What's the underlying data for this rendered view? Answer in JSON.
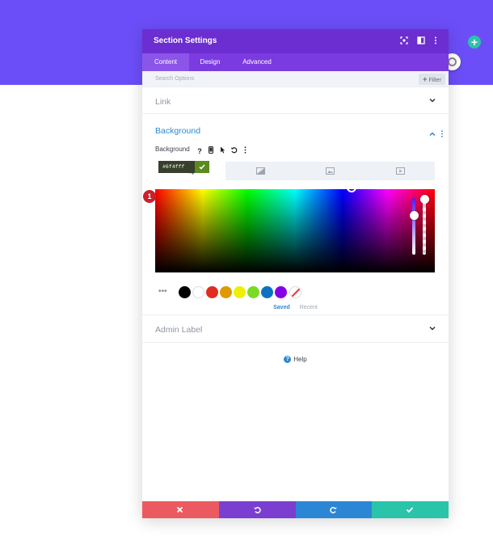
{
  "colors": {
    "top_band": "#6c4ef8",
    "header": "#6c2ed0",
    "tabs": "#7b3be0",
    "accent_blue": "#2e88cf",
    "footer_cancel": "#ec5a61",
    "footer_undo": "#7a3fd0",
    "footer_redo": "#2b87d6",
    "footer_save": "#29c4a9"
  },
  "modal": {
    "title": "Section Settings",
    "header_icons": [
      "fullscreen-icon",
      "split-view-icon",
      "more-icon"
    ],
    "tabs": [
      {
        "label": "Content",
        "active": true
      },
      {
        "label": "Design",
        "active": false
      },
      {
        "label": "Advanced",
        "active": false
      }
    ],
    "search_placeholder": "Search Options",
    "filter_label": "Filter"
  },
  "sections": {
    "link": {
      "title": "Link"
    },
    "background": {
      "title": "Background",
      "field_label": "Background",
      "field_icons": [
        "help-icon",
        "mobile-icon",
        "hover-icon",
        "reset-icon",
        "more-icon"
      ],
      "bg_type_tabs": [
        "color-icon",
        "gradient-icon",
        "image-icon",
        "video-icon"
      ],
      "active_type": "color",
      "hex_value": "#6f4fff",
      "annotation_badge": "1",
      "swatches": [
        "#000000",
        "#ffffff",
        "#e02b20",
        "#e09900",
        "#edf000",
        "#7cda24",
        "#0c71c3",
        "#8300e9"
      ],
      "palette_tabs": {
        "saved": "Saved",
        "recent": "Recent"
      }
    },
    "admin_label": {
      "title": "Admin Label"
    }
  },
  "help_label": "Help",
  "footer": [
    "cancel-icon",
    "undo-icon",
    "redo-icon",
    "save-icon"
  ]
}
